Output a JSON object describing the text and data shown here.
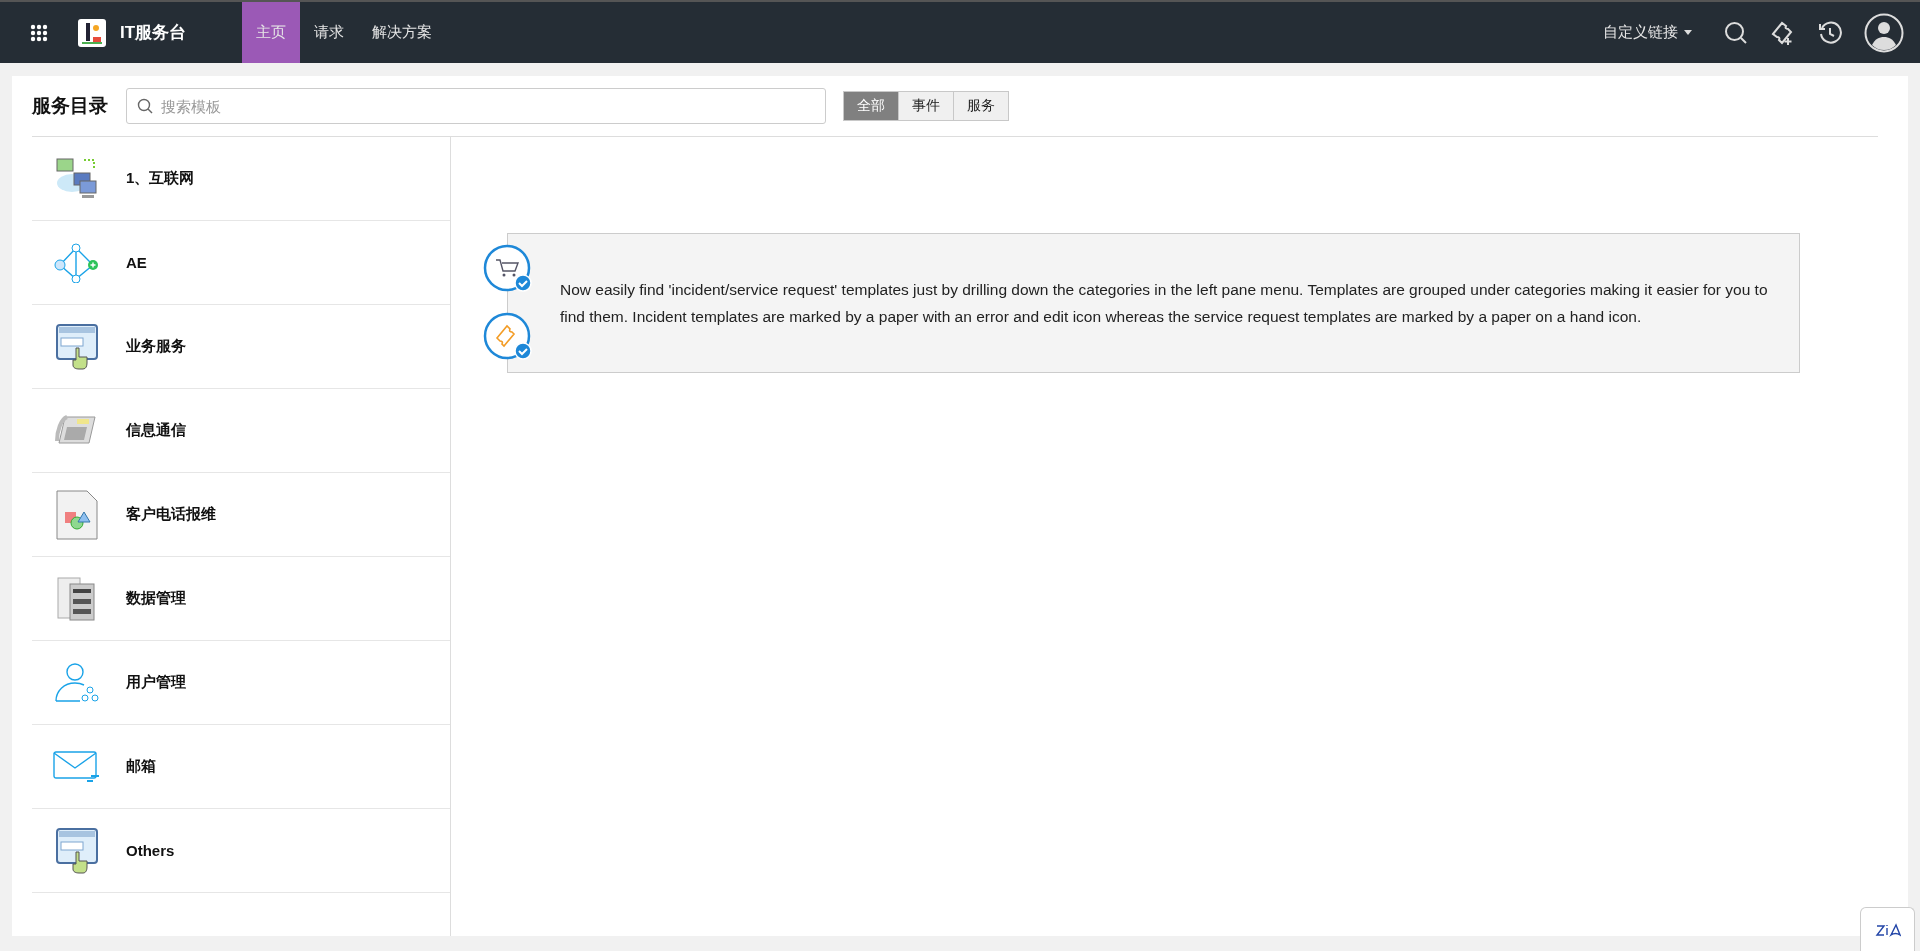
{
  "app": {
    "title": "IT服务台"
  },
  "nav": [
    {
      "label": "主页",
      "selected": true
    },
    {
      "label": "请求",
      "selected": false
    },
    {
      "label": "解决方案",
      "selected": false
    }
  ],
  "custom_links": {
    "label": "自定义链接"
  },
  "catalog": {
    "title": "服务目录",
    "search": {
      "placeholder": "搜索模板"
    },
    "filters": [
      {
        "label": "全部",
        "selected": true
      },
      {
        "label": "事件",
        "selected": false
      },
      {
        "label": "服务",
        "selected": false
      }
    ],
    "categories": [
      {
        "label": "1、互联网",
        "kind": "network"
      },
      {
        "label": "AE",
        "kind": "graph"
      },
      {
        "label": "业务服务",
        "kind": "browser"
      },
      {
        "label": "信息通信",
        "kind": "phone"
      },
      {
        "label": "客户电话报维",
        "kind": "document"
      },
      {
        "label": "数据管理",
        "kind": "server"
      },
      {
        "label": "用户管理",
        "kind": "user"
      },
      {
        "label": "邮箱",
        "kind": "mail"
      },
      {
        "label": "Others",
        "kind": "browser"
      }
    ],
    "info": "Now easily find 'incident/service request' templates just by drilling down the categories in the left pane menu. Templates are grouped under categories making it easier for you to find them. Incident templates are marked by a paper with an error and edit icon whereas the service request templates are marked by a paper on a hand icon."
  }
}
